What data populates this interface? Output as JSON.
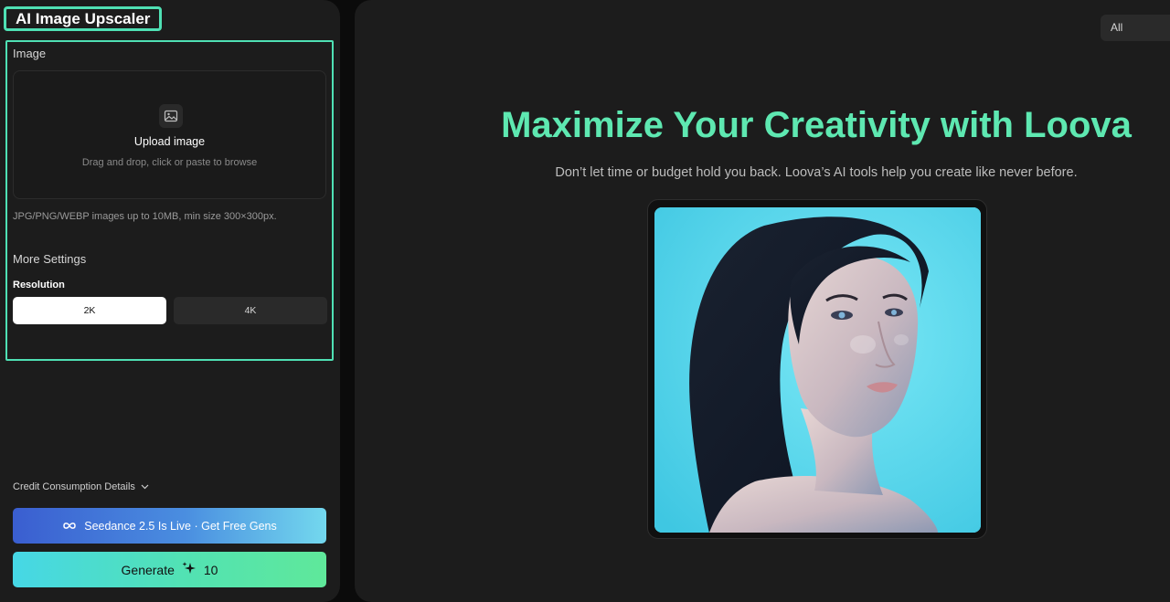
{
  "app": {
    "title": "AI Image Upscaler"
  },
  "upload": {
    "section_label": "Image",
    "title": "Upload image",
    "hint": "Drag and drop, click or paste to browse",
    "note": "JPG/PNG/WEBP images up to 10MB, min size 300×300px."
  },
  "settings": {
    "title": "More Settings",
    "resolution_label": "Resolution",
    "options": [
      "2K",
      "4K"
    ],
    "selected": "2K"
  },
  "footer": {
    "credit_details": "Credit Consumption Details",
    "promo_label": "Seedance 2.5 Is Live · Get Free Gens",
    "generate_label": "Generate",
    "generate_cost": "10"
  },
  "main": {
    "filter_value": "All",
    "hero_title": "Maximize Your Creativity with Loova",
    "hero_subtitle": "Don’t let time or budget hold you back. Loova’s AI tools help you create like never before."
  },
  "colors": {
    "accent": "#5ee8b1",
    "panel": "#1c1c1c",
    "background": "#0b0b0b",
    "portrait_bg": "#5fdcf0"
  },
  "icons": [
    "image-icon",
    "chevron-down-icon",
    "infinity-icon",
    "sparkle-icon"
  ]
}
